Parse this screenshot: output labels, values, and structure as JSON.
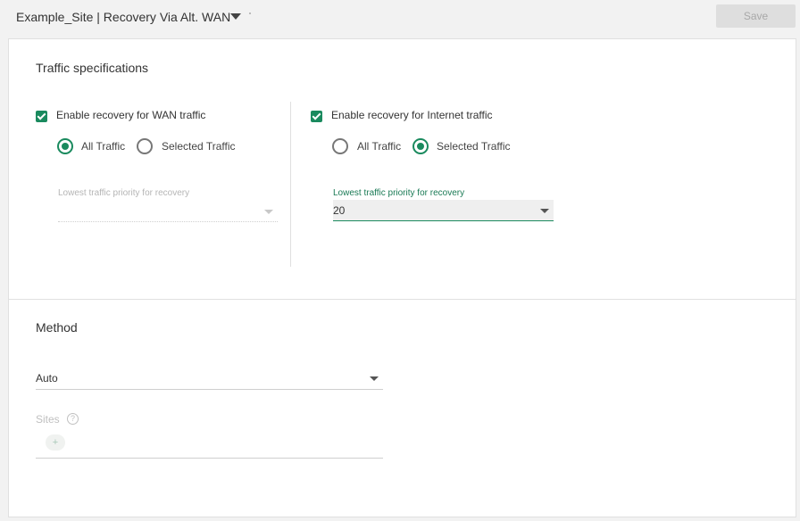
{
  "header": {
    "title": "Example_Site | Recovery Via Alt. WAN",
    "save_label": "Save"
  },
  "traffic": {
    "section_title": "Traffic specifications",
    "wan": {
      "checkbox_label": "Enable recovery for WAN traffic",
      "checked": true,
      "radio_all": "All Traffic",
      "radio_selected": "Selected Traffic",
      "selected_option": "All Traffic",
      "priority_label": "Lowest traffic priority for recovery",
      "priority_value": ""
    },
    "internet": {
      "checkbox_label": "Enable recovery for Internet traffic",
      "checked": true,
      "radio_all": "All Traffic",
      "radio_selected": "Selected Traffic",
      "selected_option": "Selected Traffic",
      "priority_label": "Lowest traffic priority for recovery",
      "priority_value": "20"
    }
  },
  "method": {
    "section_title": "Method",
    "value": "Auto",
    "sites_label": "Sites",
    "help_icon": "?",
    "add_icon": "+"
  },
  "colors": {
    "accent": "#1a8a5e",
    "disabled_text": "#b5b5b5"
  },
  "icons": [
    "chevron-down-icon",
    "check-icon",
    "help-icon",
    "plus-icon"
  ]
}
